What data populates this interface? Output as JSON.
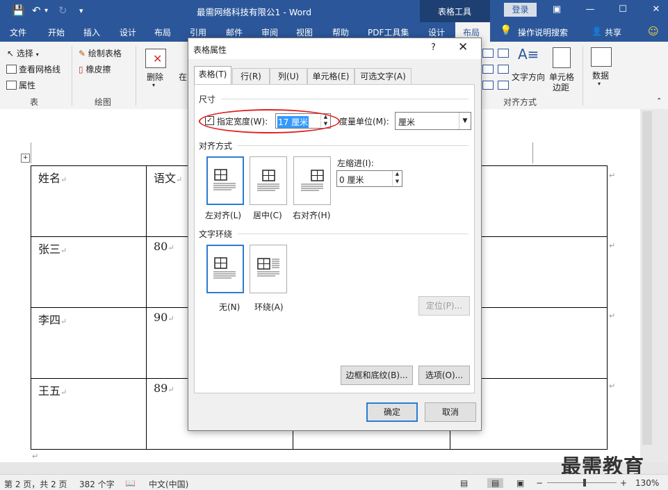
{
  "title_bar": {
    "doc_title": "最需网络科技有限公1  -  Word",
    "context_group": "表格工具",
    "login": "登录"
  },
  "tabs": [
    "文件",
    "开始",
    "插入",
    "设计",
    "布局",
    "引用",
    "邮件",
    "审阅",
    "视图",
    "帮助",
    "PDF工具集",
    "设计",
    "布局"
  ],
  "tell_me": "操作说明搜索",
  "share": "共享",
  "ribbon": {
    "select": "选择",
    "view_gridlines": "查看网格线",
    "properties": "属性",
    "group_table": "表",
    "draw_table": "绘制表格",
    "eraser": "橡皮擦",
    "group_draw": "绘图",
    "delete": "删除",
    "insert_partial": "在",
    "text_direction": "文字方向",
    "cell_margins_1": "单元格",
    "cell_margins_2": "边距",
    "group_align": "对齐方式",
    "data": "数据"
  },
  "table": {
    "rows": [
      [
        "姓名",
        "语文"
      ],
      [
        "张三",
        "80"
      ],
      [
        "李四",
        "90"
      ],
      [
        "王五",
        "89"
      ]
    ]
  },
  "dialog": {
    "title": "表格属性",
    "help": "?",
    "tabs": [
      "表格(T)",
      "行(R)",
      "列(U)",
      "单元格(E)",
      "可选文字(A)"
    ],
    "size_section": "尺寸",
    "preferred_width_label": "指定宽度(W):",
    "preferred_width_checked": true,
    "preferred_width_value": "17 厘米",
    "measure_label": "度量单位(M):",
    "measure_value": "厘米",
    "alignment_section": "对齐方式",
    "align_options": [
      "左对齐(L)",
      "居中(C)",
      "右对齐(H)"
    ],
    "indent_label": "左缩进(I):",
    "indent_value": "0 厘米",
    "wrap_section": "文字环绕",
    "wrap_options": [
      "无(N)",
      "环绕(A)"
    ],
    "position_button": "定位(P)...",
    "borders_button": "边框和底纹(B)...",
    "options_button": "选项(O)...",
    "ok_button": "确定",
    "cancel_button": "取消"
  },
  "status": {
    "page": "第 2 页，共 2 页",
    "words": "382 个字",
    "language": "中文(中国)",
    "zoom": "130%"
  },
  "watermark": "最需教育",
  "colors": {
    "word_blue": "#2b579a",
    "highlight": "#2b7cd3",
    "annotation": "#e02020"
  }
}
